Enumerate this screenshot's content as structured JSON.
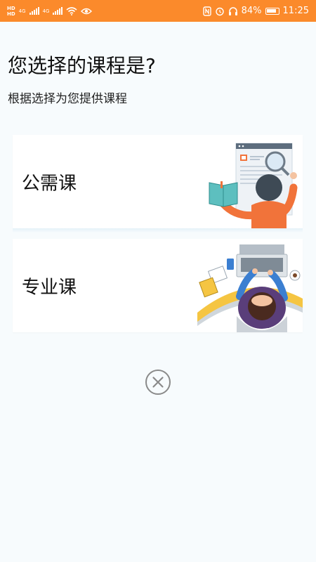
{
  "status_bar": {
    "battery": "84%",
    "time": "11:25",
    "network_labels": [
      "4G",
      "4G"
    ],
    "hd_label": "HD"
  },
  "page": {
    "title": "您选择的课程是?",
    "subtitle": "根据选择为您提供课程"
  },
  "options": [
    {
      "label": "公需课",
      "illustration": "reading-magnifier-illustration"
    },
    {
      "label": "专业课",
      "illustration": "laptop-desk-illustration"
    }
  ],
  "close": {
    "icon": "close-circle-icon"
  },
  "colors": {
    "status_bar": "#fb8a2b",
    "background": "#f7fbfd",
    "card": "#ffffff",
    "accent_orange": "#f1733a",
    "accent_blue": "#3b7fd1",
    "close_gray": "#8a8a8a"
  }
}
